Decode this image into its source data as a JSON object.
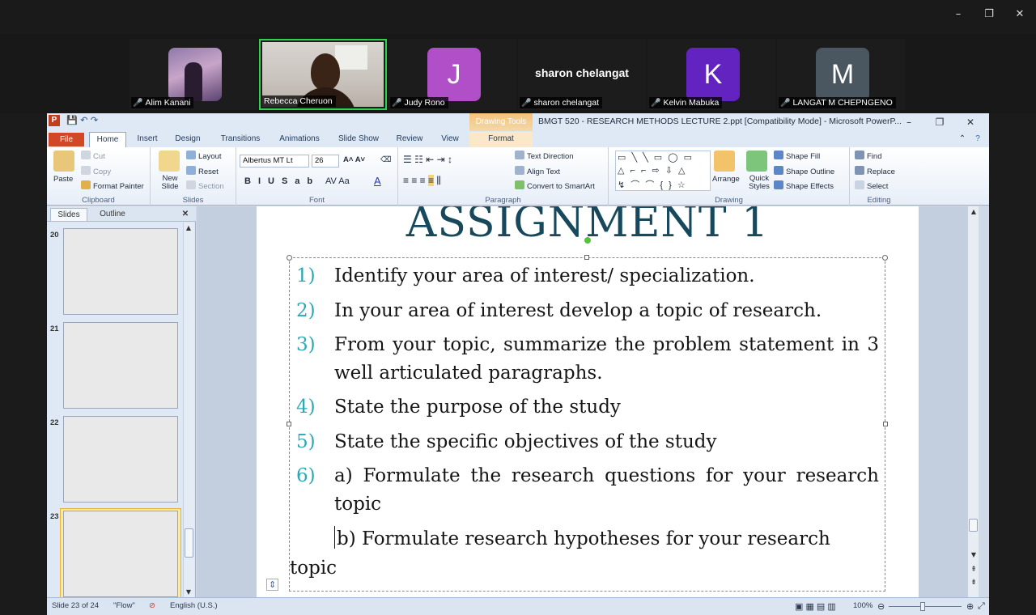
{
  "zoom": {
    "participants": [
      {
        "name": "Alim Kanani",
        "type": "image"
      },
      {
        "name": "Rebecca Cheruon",
        "type": "video",
        "active": true
      },
      {
        "name": "Judy Rono",
        "initial": "J",
        "color": "#b04fc7"
      },
      {
        "name": "sharon chelangat",
        "display_name": "sharon chelangat"
      },
      {
        "name": "Kelvin Mabuka",
        "initial": "K",
        "color": "#6323c0"
      },
      {
        "name": "LANGAT M CHEPNGENO",
        "initial": "M",
        "color": "#4a5660"
      }
    ],
    "window_controls": {
      "minimize": "–",
      "restore": "❐",
      "close": "✕"
    }
  },
  "ppt": {
    "contextual_tab": "Drawing Tools",
    "title": "BMGT 520 - RESEARCH METHODS LECTURE 2.ppt [Compatibility Mode] - Microsoft PowerP...",
    "tabs": [
      "File",
      "Home",
      "Insert",
      "Design",
      "Transitions",
      "Animations",
      "Slide Show",
      "Review",
      "View",
      "Format"
    ],
    "ribbon": {
      "clipboard": {
        "label": "Clipboard",
        "paste": "Paste",
        "cut": "Cut",
        "copy": "Copy",
        "format_painter": "Format Painter"
      },
      "slides": {
        "label": "Slides",
        "new_slide": "New Slide",
        "layout": "Layout",
        "reset": "Reset",
        "section": "Section"
      },
      "font": {
        "label": "Font",
        "font_name": "Albertus MT Lt",
        "font_size": "26"
      },
      "paragraph": {
        "label": "Paragraph",
        "text_direction": "Text Direction",
        "align_text": "Align Text",
        "convert_smartart": "Convert to SmartArt"
      },
      "drawing": {
        "label": "Drawing",
        "arrange": "Arrange",
        "quick_styles": "Quick Styles",
        "shape_fill": "Shape Fill",
        "shape_outline": "Shape Outline",
        "shape_effects": "Shape Effects"
      },
      "editing": {
        "label": "Editing",
        "find": "Find",
        "replace": "Replace",
        "select": "Select"
      }
    },
    "pane": {
      "tabs": [
        "Slides",
        "Outline"
      ],
      "thumbnails": [
        "20",
        "21",
        "22",
        "23"
      ],
      "selected": "23"
    },
    "slide": {
      "title": "ASSIGNMENT 1",
      "items": [
        {
          "num": "1)",
          "text": "Identify your area of interest/ specialization."
        },
        {
          "num": "2)",
          "text": "In your area of interest develop a topic of research."
        },
        {
          "num": "3)",
          "text": "From your topic, summarize the problem statement in 3 well articulated paragraphs."
        },
        {
          "num": "4)",
          "text": "State the purpose of the study"
        },
        {
          "num": "5)",
          "text": "State the specific objectives of the study"
        },
        {
          "num": "6)",
          "text": "a) Formulate the research questions for your research topic"
        }
      ],
      "item_b": "b) Formulate research hypotheses for your research",
      "item_b_cont": "topic"
    },
    "status": {
      "slide": "Slide 23 of 24",
      "theme": "\"Flow\"",
      "language": "English (U.S.)",
      "zoom": "100%"
    },
    "colors": {
      "accent_title": "#17485c",
      "number_color": "#2aa9b5",
      "file_tab": "#d24726"
    }
  }
}
